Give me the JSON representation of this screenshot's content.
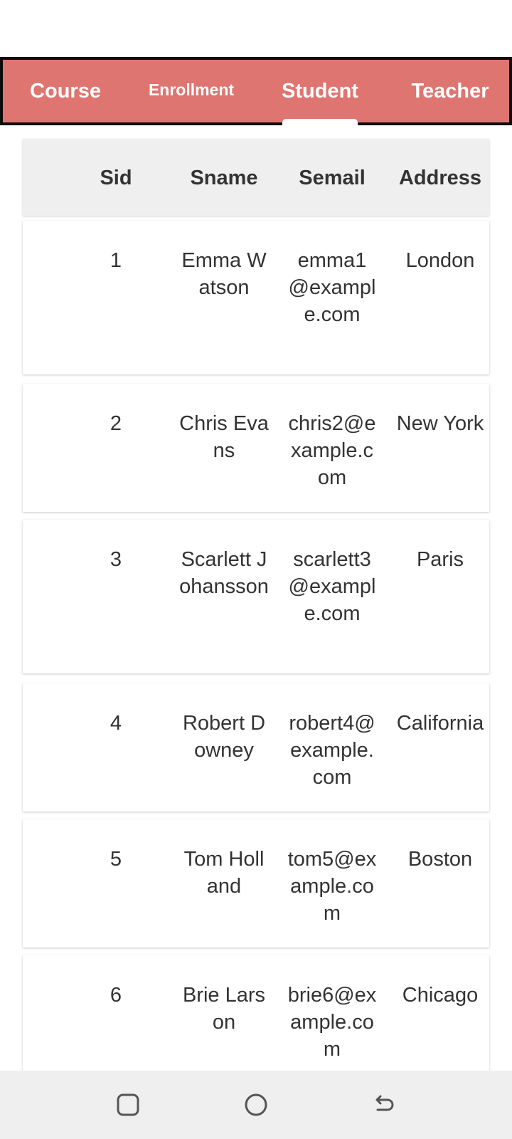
{
  "tabs": [
    {
      "label": "Course"
    },
    {
      "label": "Enrollment"
    },
    {
      "label": "Student"
    },
    {
      "label": "Teacher"
    }
  ],
  "active_tab": "Student",
  "table": {
    "headers": [
      "Sid",
      "Sname",
      "Semail",
      "Address"
    ],
    "rows": [
      {
        "sid": "1",
        "sname": "Emma Watson",
        "semail": "emma1@example.com",
        "address": "London"
      },
      {
        "sid": "2",
        "sname": "Chris Evans",
        "semail": "chris2@example.com",
        "address": "New York"
      },
      {
        "sid": "3",
        "sname": "Scarlett Johansson",
        "semail": "scarlett3@example.com",
        "address": "Paris"
      },
      {
        "sid": "4",
        "sname": "Robert Downey",
        "semail": "robert4@example.com",
        "address": "California"
      },
      {
        "sid": "5",
        "sname": "Tom Holland",
        "semail": "tom5@example.com",
        "address": "Boston"
      },
      {
        "sid": "6",
        "sname": "Brie Larson",
        "semail": "brie6@example.com",
        "address": "Chicago"
      }
    ]
  },
  "nav": {
    "recents": "recents-icon",
    "home": "home-icon",
    "back": "back-icon"
  },
  "colors": {
    "tab_bar": "#df7570",
    "tab_bar_border": "#0b0b0b",
    "header_bg": "#efefef",
    "nav_bg": "#efefef",
    "text": "#333333"
  }
}
